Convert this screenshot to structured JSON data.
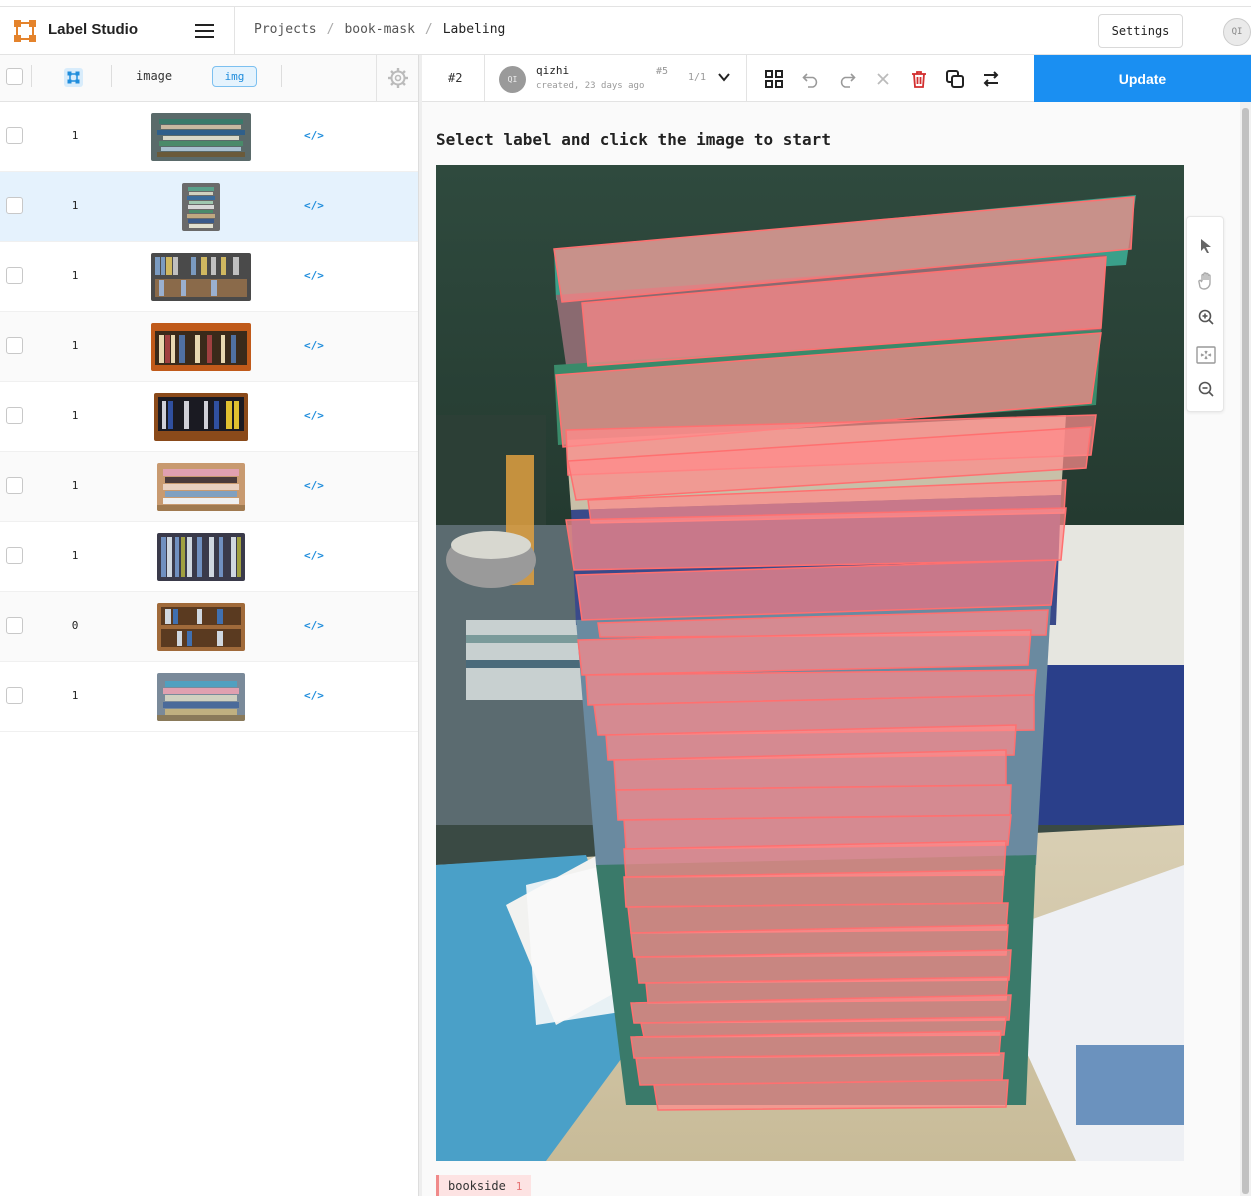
{
  "app": {
    "title": "Label Studio"
  },
  "breadcrumbs": [
    "Projects",
    "/",
    "book-mask",
    "/",
    "Labeling"
  ],
  "header": {
    "settings_label": "Settings",
    "user_initials": "QI"
  },
  "table": {
    "columns": {
      "image": "image",
      "img": "img"
    },
    "rows": [
      {
        "count": "1",
        "selected": false
      },
      {
        "count": "1",
        "selected": true
      },
      {
        "count": "1",
        "selected": false
      },
      {
        "count": "1",
        "selected": false
      },
      {
        "count": "1",
        "selected": false
      },
      {
        "count": "1",
        "selected": false
      },
      {
        "count": "1",
        "selected": false
      },
      {
        "count": "0",
        "selected": false
      },
      {
        "count": "1",
        "selected": false
      }
    ]
  },
  "annotation_bar": {
    "task_id": "#2",
    "user_initials": "QI",
    "user_name": "qizhi",
    "created": "created, 23 days ago",
    "annotation_id": "#5",
    "pager": "1/1",
    "update_label": "Update"
  },
  "labeling": {
    "instruction": "Select label and click the image to start",
    "region_label": "bookside",
    "region_count": "1",
    "mask_color": "#ff8a8a"
  },
  "colors": {
    "accent": "#1a8ff2",
    "selection_row": "#e5f2fd",
    "delete_icon": "#d32f2f"
  }
}
